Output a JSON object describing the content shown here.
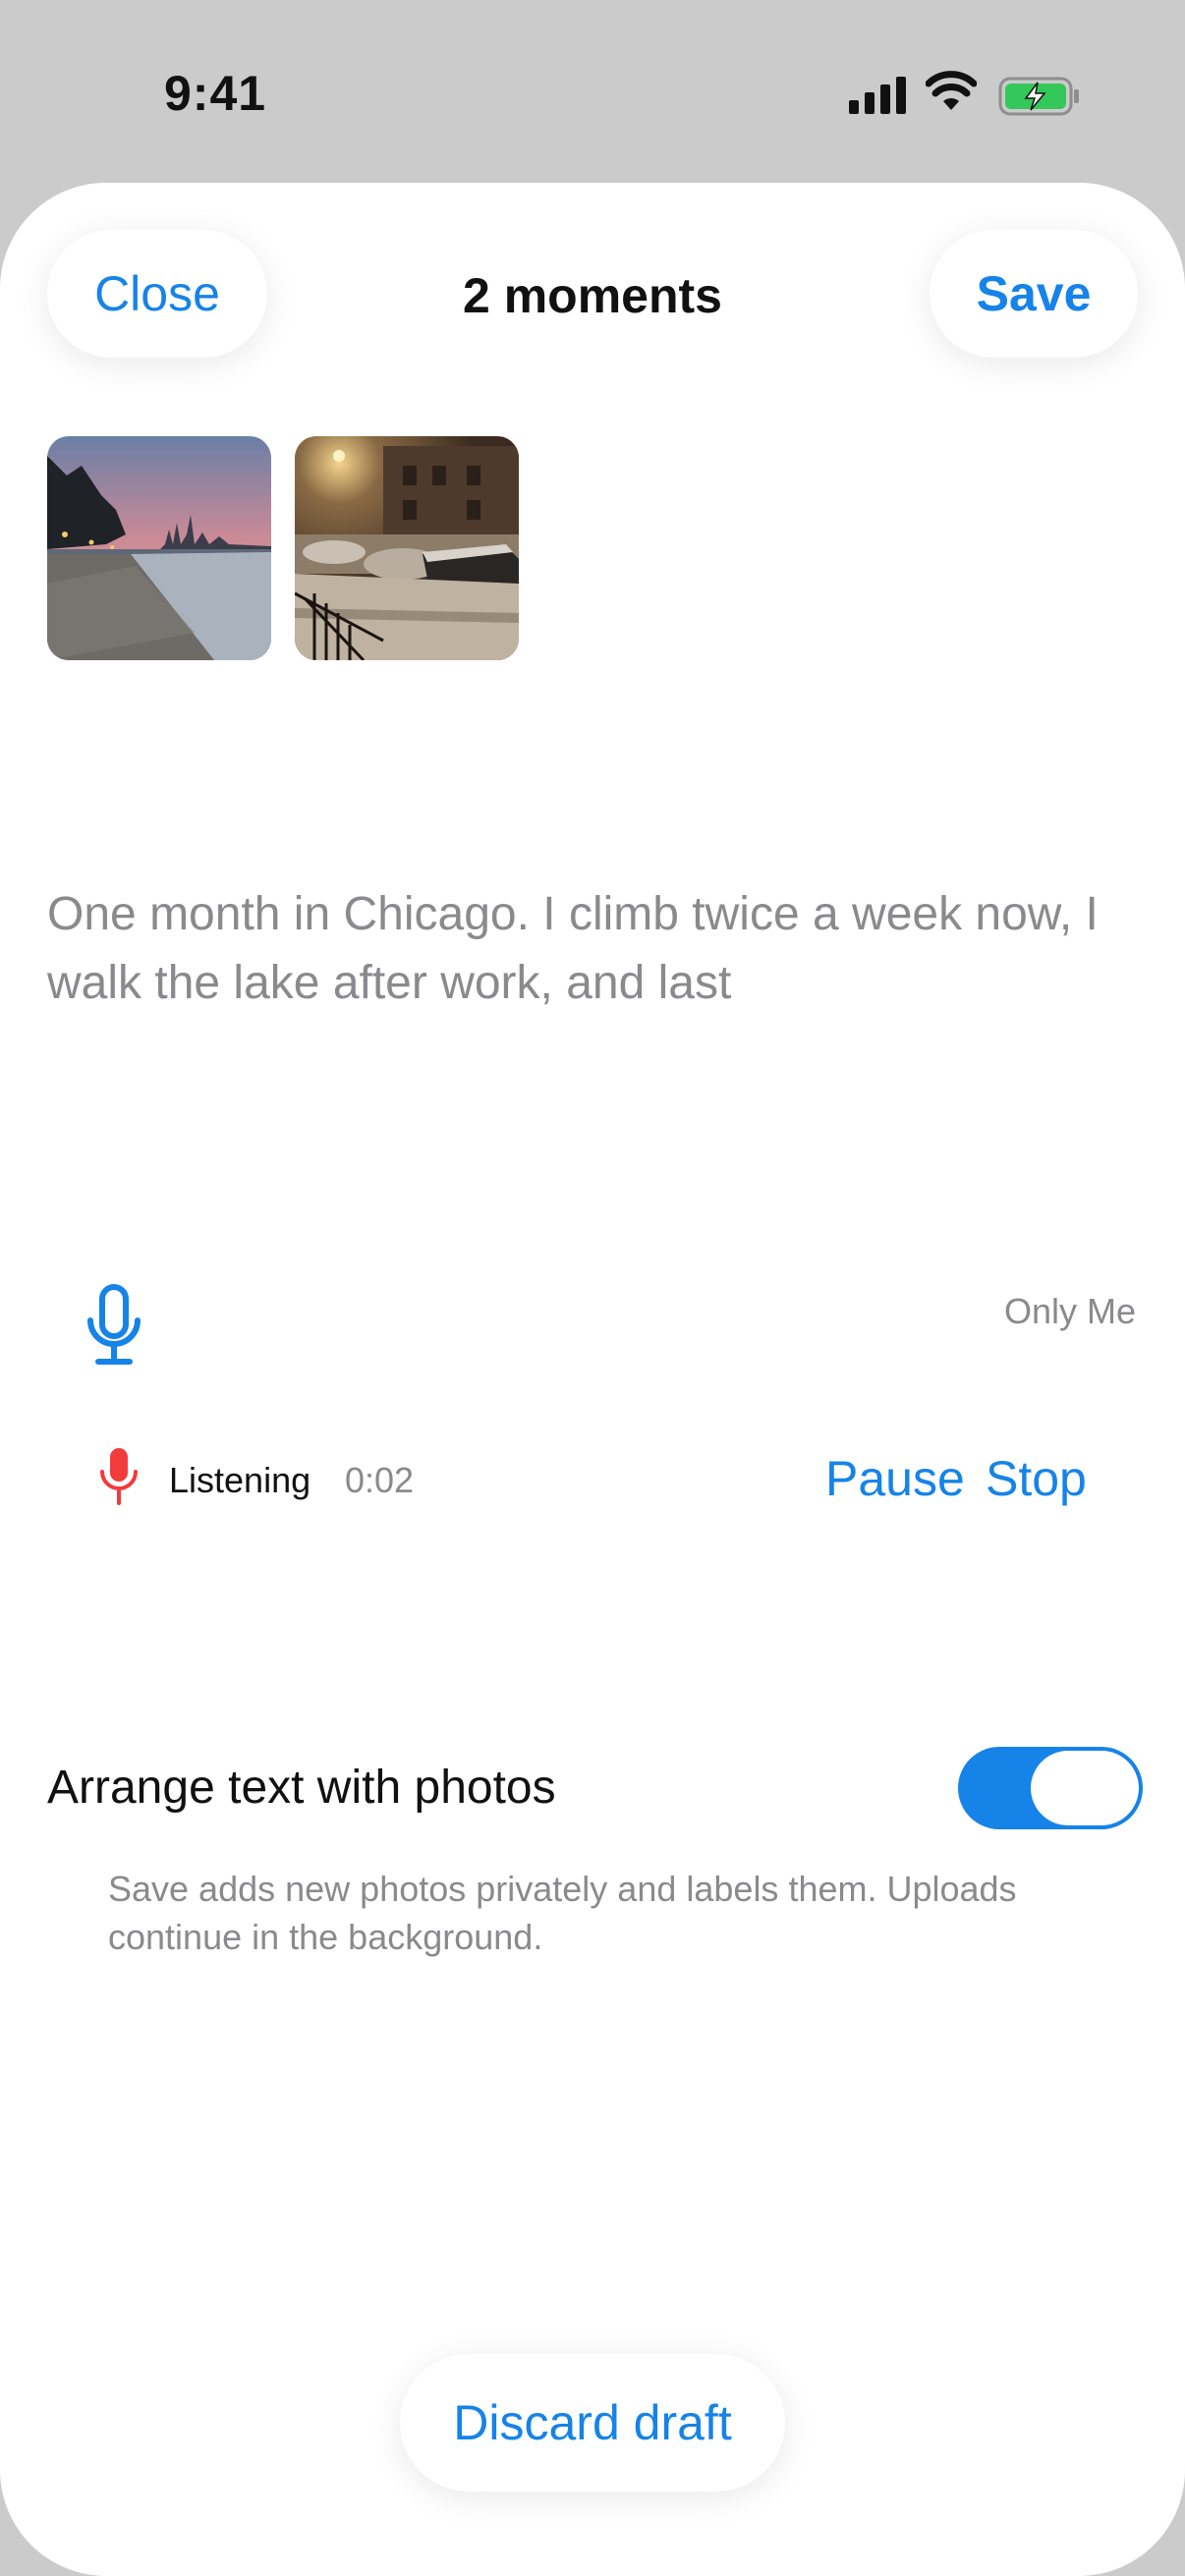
{
  "status_bar": {
    "time": "9:41",
    "battery_color": "#34c759"
  },
  "header": {
    "close_label": "Close",
    "title": "2 moments",
    "save_label": "Save"
  },
  "photos": [
    {
      "description_icon": "lakefront-sunset-photo"
    },
    {
      "description_icon": "snowy-street-night-photo"
    }
  ],
  "entry": {
    "text": "One month in Chicago. I climb twice a week now, I walk the lake after work, and last"
  },
  "toolbar": {
    "mic_icon": "microphone-icon",
    "privacy_label": "Only Me"
  },
  "recording": {
    "status_label": "Listening",
    "elapsed": "0:02",
    "pause_label": "Pause",
    "stop_label": "Stop"
  },
  "arrange": {
    "label": "Arrange text with photos",
    "enabled": true,
    "helper_text": "Save adds new photos privately and labels them. Uploads continue in the background."
  },
  "footer": {
    "discard_label": "Discard draft"
  },
  "colors": {
    "accent": "#1683e8",
    "recording": "#f23b3b",
    "secondary_text": "#8a8a8e"
  }
}
